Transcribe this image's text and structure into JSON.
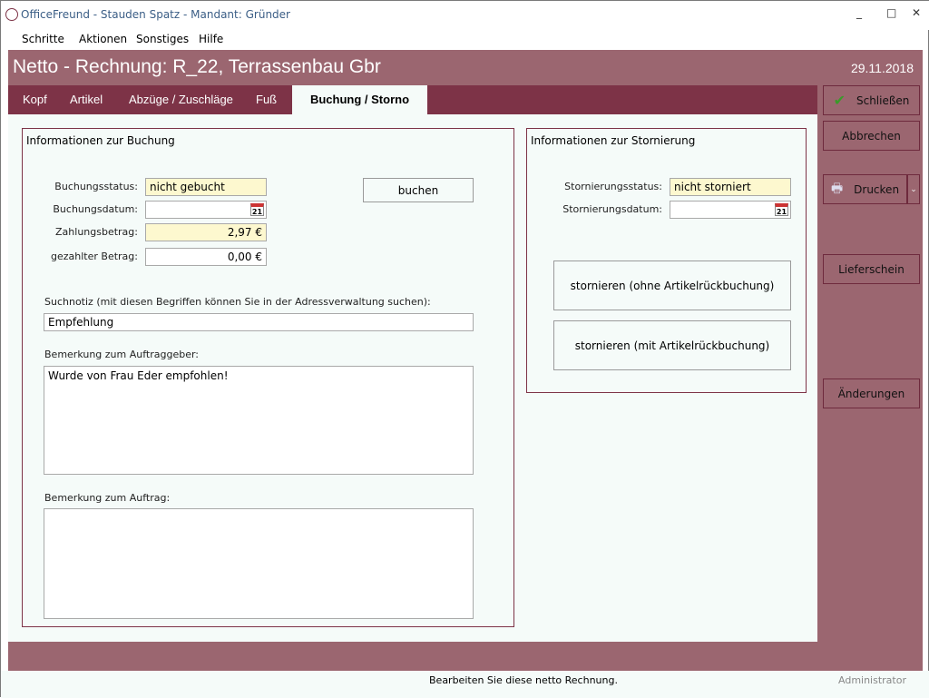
{
  "window": {
    "title": "OfficeFreund  -  Stauden Spatz  -  Mandant: Gründer",
    "min": "_",
    "max": "□",
    "close": "✕"
  },
  "menu": [
    "Schritte",
    "Aktionen",
    "Sonstiges",
    "Hilfe"
  ],
  "header": {
    "title": "Netto - Rechnung: R_22, Terrassenbau Gbr",
    "date": "29.11.2018"
  },
  "tabs": [
    "Kopf",
    "Artikel",
    "Abzüge / Zuschläge",
    "Fuß",
    "Buchung / Storno"
  ],
  "buchung": {
    "title": "Informationen zur Buchung",
    "status_label": "Buchungsstatus:",
    "status": "nicht gebucht",
    "datum_label": "Buchungsdatum:",
    "datum": "",
    "betrag_label": "Zahlungsbetrag:",
    "betrag": "2,97 €",
    "gezahlt_label": "gezahlter Betrag:",
    "gezahlt": "0,00 €",
    "buchen": "buchen",
    "suchnotiz_label": "Suchnotiz (mit diesen Begriffen können Sie in der Adressverwaltung suchen):",
    "suchnotiz": "Empfehlung",
    "bem_auftraggeber_label": "Bemerkung zum Auftraggeber:",
    "bem_auftraggeber": "Wurde von Frau Eder empfohlen!",
    "bem_auftrag_label": "Bemerkung zum Auftrag:",
    "bem_auftrag": "",
    "cal": "21"
  },
  "storno": {
    "title": "Informationen zur Stornierung",
    "status_label": "Stornierungsstatus:",
    "status": "nicht storniert",
    "datum_label": "Stornierungsdatum:",
    "datum": "",
    "btn1": "stornieren (ohne Artikelrückbuchung)",
    "btn2": "stornieren (mit Artikelrückbuchung)"
  },
  "sidebar": {
    "close": "Schließen",
    "cancel": "Abbrechen",
    "print": "Drucken",
    "delivery": "Lieferschein",
    "changes": "Änderungen"
  },
  "status": {
    "message": "Bearbeiten Sie diese netto Rechnung.",
    "user": "Administrator"
  },
  "colors": {
    "band": "#9b6670",
    "tabs": "#7d3347",
    "content": "#f5fbf9"
  }
}
